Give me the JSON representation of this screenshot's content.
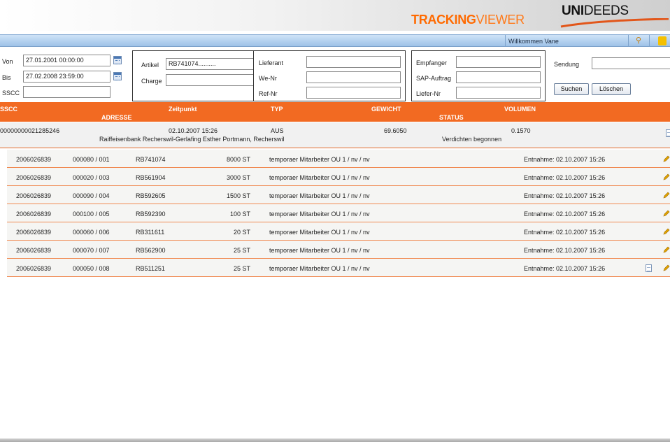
{
  "brand": {
    "tracking_bold": "TRACKING",
    "tracking_light": "VIEWER",
    "uni": "UNI",
    "deeds": "DEEDS"
  },
  "welcome": {
    "text": "Willkommen Vane"
  },
  "filters": {
    "von_label": "Von",
    "von_value": "27.01.2001 00:00:00",
    "bis_label": "Bis",
    "bis_value": "27.02.2008 23:59:00",
    "sscc_label": "SSCC",
    "sscc_value": "",
    "artikel_label": "Artikel",
    "artikel_value": "RB741074..........",
    "charge_label": "Charge",
    "charge_value": "",
    "lieferant_label": "Lieferant",
    "lieferant_value": "",
    "wenr_label": "We-Nr",
    "wenr_value": "",
    "refnr_label": "Ref-Nr",
    "refnr_value": "",
    "empfaenger_label": "Empfanger",
    "empfaenger_value": "",
    "sapauftrag_label": "SAP-Auftrag",
    "sapauftrag_value": "",
    "liefernr_label": "Liefer-Nr",
    "liefernr_value": "",
    "sendung_label": "Sendung",
    "sendung_value": "",
    "suchen_label": "Suchen",
    "loeschen_label": "Löschen"
  },
  "columns": {
    "sscc": "SSCC",
    "adresse": "ADRESSE",
    "zeitpunkt": "Zeitpunkt",
    "typ": "TYP",
    "gewicht": "GEWICHT",
    "status": "STATUS",
    "volumen": "VOLUMEN"
  },
  "parent": {
    "sscc": "00000000021285246",
    "zeitpunkt": "02.10.2007 15:26",
    "typ": "AUS",
    "gewicht": "69.6050",
    "volumen": "0.1570",
    "adresse": "Raiffeisenbank Recherswil-Gerlafing Esther Portmann, Recherswil",
    "status": "Verdichten begonnen"
  },
  "items": [
    {
      "order": "2006026839",
      "pos": "000080 / 001",
      "artikel": "RB741074",
      "menge": "8000 ST",
      "text": "temporaer Mitarbeiter OU 1 / nv / nv",
      "entnahme": "Entnahme: 02.10.2007 15:26"
    },
    {
      "order": "2006026839",
      "pos": "000020 / 003",
      "artikel": "RB561904",
      "menge": "3000 ST",
      "text": "temporaer Mitarbeiter OU 1 / nv / nv",
      "entnahme": "Entnahme: 02.10.2007 15:26"
    },
    {
      "order": "2006026839",
      "pos": "000090 / 004",
      "artikel": "RB592605",
      "menge": "1500 ST",
      "text": "temporaer Mitarbeiter OU 1 / nv / nv",
      "entnahme": "Entnahme: 02.10.2007 15:26"
    },
    {
      "order": "2006026839",
      "pos": "000100 / 005",
      "artikel": "RB592390",
      "menge": "100 ST",
      "text": "temporaer Mitarbeiter OU 1 / nv / nv",
      "entnahme": "Entnahme: 02.10.2007 15:26"
    },
    {
      "order": "2006026839",
      "pos": "000060 / 006",
      "artikel": "RB311611",
      "menge": "20 ST",
      "text": "temporaer Mitarbeiter OU 1 / nv / nv",
      "entnahme": "Entnahme: 02.10.2007 15:26"
    },
    {
      "order": "2006026839",
      "pos": "000070 / 007",
      "artikel": "RB562900",
      "menge": "25 ST",
      "text": "temporaer Mitarbeiter OU 1 / nv / nv",
      "entnahme": "Entnahme: 02.10.2007 15:26"
    },
    {
      "order": "2006026839",
      "pos": "000050 / 008",
      "artikel": "RB511251",
      "menge": "25 ST",
      "text": "temporaer Mitarbeiter OU 1 / nv / nv",
      "entnahme": "Entnahme: 02.10.2007 15:26"
    }
  ],
  "colors": {
    "accent": "#f26a22",
    "header_blue": "#9ec2e8",
    "logo_orange": "#ff6a00"
  }
}
